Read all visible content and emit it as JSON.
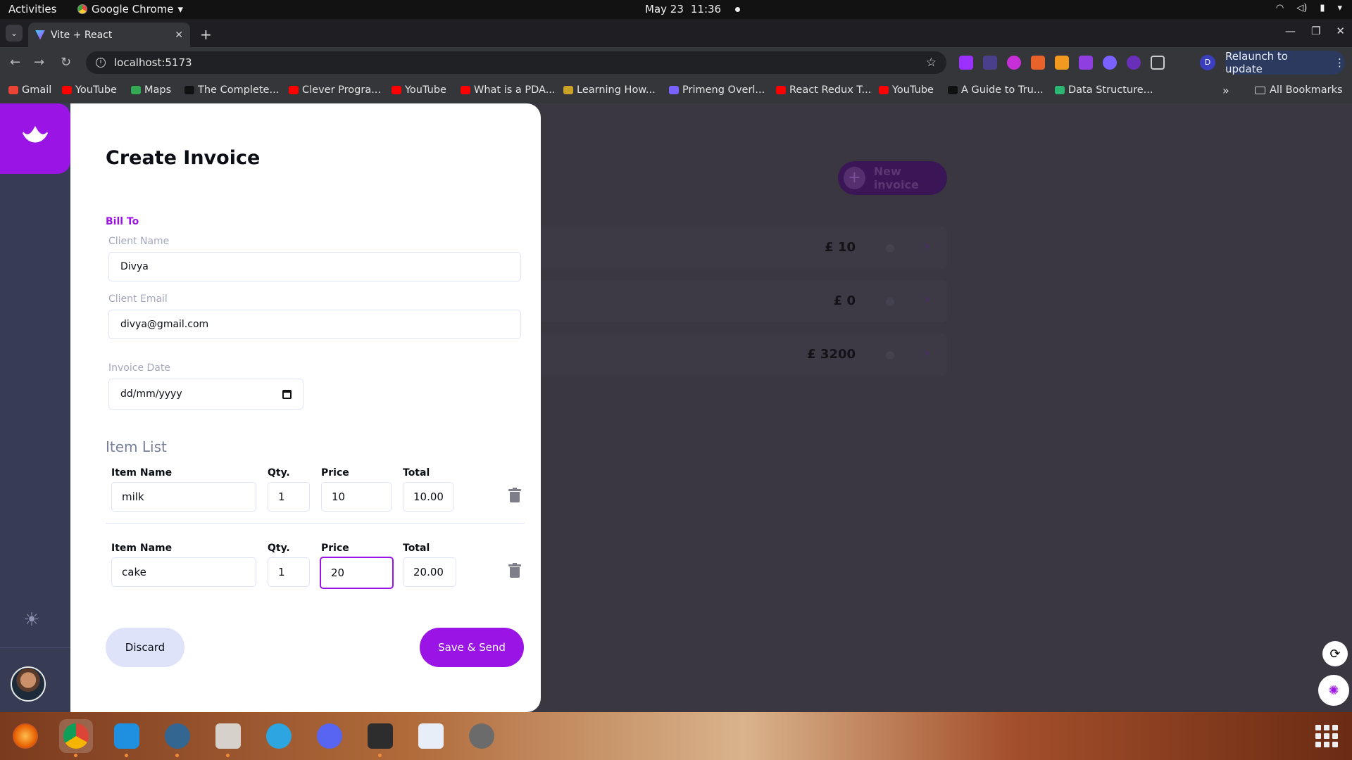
{
  "topbar": {
    "activities": "Activities",
    "app_name": "Google Chrome",
    "date": "May 23",
    "time": "11:36"
  },
  "browser": {
    "tab_title": "Vite + React",
    "url": "localhost:5173",
    "relaunch_label": "Relaunch to update",
    "profile_initial": "D",
    "bookmarks": [
      {
        "label": "Gmail",
        "color": "#ea4335"
      },
      {
        "label": "YouTube",
        "color": "#ff0000"
      },
      {
        "label": "Maps",
        "color": "#34a853"
      },
      {
        "label": "The Complete...",
        "color": "#111111"
      },
      {
        "label": "Clever Progra...",
        "color": "#ff0000"
      },
      {
        "label": "YouTube",
        "color": "#ff0000"
      },
      {
        "label": "What is a PDA...",
        "color": "#ff0000"
      },
      {
        "label": "Learning How...",
        "color": "#c9a227"
      },
      {
        "label": "Primeng Overl...",
        "color": "#7b61ff"
      },
      {
        "label": "React Redux T...",
        "color": "#ff0000"
      },
      {
        "label": "YouTube",
        "color": "#ff0000"
      },
      {
        "label": "A Guide to Tru...",
        "color": "#111111"
      },
      {
        "label": "Data Structure...",
        "color": "#2bb673"
      }
    ],
    "all_bookmarks": "All Bookmarks"
  },
  "app": {
    "accent_color": "#9b14e6",
    "new_invoice_label": "New invoice",
    "invoices": [
      {
        "amount": "£ 10"
      },
      {
        "amount": "£ 0"
      },
      {
        "amount": "£ 3200"
      }
    ]
  },
  "form": {
    "title": "Create Invoice",
    "bill_to": "Bill To",
    "client_name_label": "Client Name",
    "client_name": "Divya",
    "client_email_label": "Client Email",
    "client_email": "divya@gmail.com",
    "invoice_date_label": "Invoice Date",
    "invoice_date_placeholder": "dd/mm/yyyy",
    "item_list_title": "Item List",
    "columns": {
      "name": "Item Name",
      "qty": "Qty.",
      "price": "Price",
      "total": "Total"
    },
    "items": [
      {
        "name": "milk",
        "qty": "1",
        "price": "10",
        "total": "10.00"
      },
      {
        "name": "cake",
        "qty": "1",
        "price": "20",
        "total": "20.00"
      }
    ],
    "discard_label": "Discard",
    "save_label": "Save & Send"
  }
}
